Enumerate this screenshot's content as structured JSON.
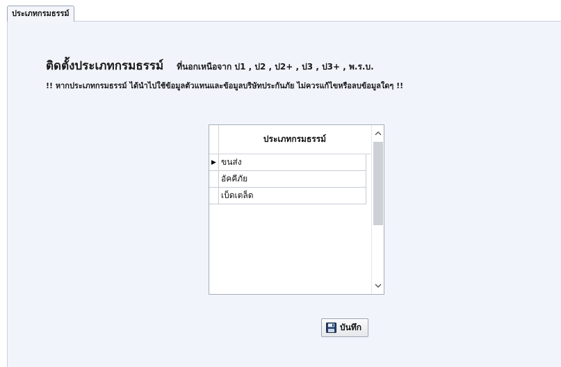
{
  "tab": {
    "label": "ประเภทกรมธรรม์"
  },
  "header": {
    "title": "ติดตั้งประเภทกรมธรรม์",
    "subtitle": "ที่นอกเหนือจาก ป1 , ป2 , ป2+ , ป3 , ป3+ , พ.ร.บ.",
    "warning": "!! หากประเภทกรมธรรม์ ได้นำไปใช้ข้อมูลตัวแทนและข้อมูลบริษัทประกันภัย ไม่ควรแก้ไขหรือลบข้อมูลใดๆ !!"
  },
  "grid": {
    "column_header": "ประเภทกรมธรรม์",
    "current_row_marker": "▶",
    "rows": [
      {
        "value": "ขนส่ง"
      },
      {
        "value": "อัคคีภัย"
      },
      {
        "value": "เบ็ดเตล็ด"
      }
    ],
    "scroll_up_icon": "chevron-up-icon",
    "scroll_down_icon": "chevron-down-icon"
  },
  "actions": {
    "save_label": "บันทึก",
    "save_icon": "floppy-disk-icon"
  }
}
